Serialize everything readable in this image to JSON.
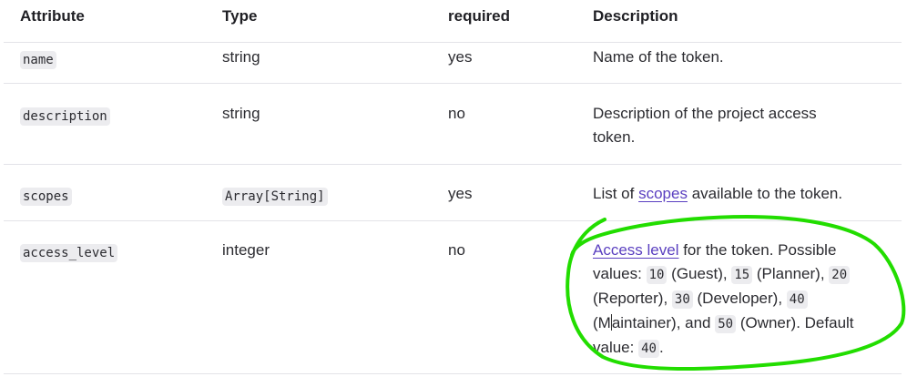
{
  "headers": {
    "attribute": "Attribute",
    "type": "Type",
    "required": "required",
    "description": "Description"
  },
  "rows": [
    {
      "attribute": "name",
      "type": "string",
      "required": "yes",
      "description": "Name of the token."
    },
    {
      "attribute": "description",
      "type": "string",
      "required": "no",
      "description_line1": "Description of the project access",
      "description_line2": "token."
    },
    {
      "attribute": "scopes",
      "type": "Array[String]",
      "required": "yes",
      "description_pre": "List of ",
      "description_link": "scopes",
      "description_post": " available to the token."
    },
    {
      "attribute": "access_level",
      "type": "integer",
      "required": "no",
      "desc": {
        "link": "Access level",
        "t1": " for the token. Possible",
        "t2": "values: ",
        "v10": "10",
        "guest": " (Guest), ",
        "v15": "15",
        "planner": " (Planner), ",
        "v20": "20",
        "reporter": "(Reporter), ",
        "v30": "30",
        "developer": " (Developer), ",
        "v40": "40",
        "maint_a": "(M",
        "maint_b": "aintainer), and ",
        "v50": "50",
        "owner": " (Owner). Default",
        "value_label": "value: ",
        "v40b": "40",
        "end": "."
      }
    }
  ],
  "annotation": {
    "color": "#22dd00"
  }
}
